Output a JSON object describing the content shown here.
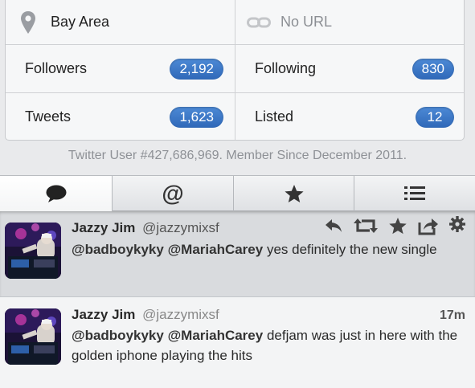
{
  "profile": {
    "location": "Bay Area",
    "url": "No URL",
    "followers_label": "Followers",
    "followers_count": "2,192",
    "following_label": "Following",
    "following_count": "830",
    "tweets_label": "Tweets",
    "tweets_count": "1,623",
    "listed_label": "Listed",
    "listed_count": "12",
    "member_line": "Twitter User #427,686,969. Member Since December 2011."
  },
  "tabs": [
    {
      "icon": "speech-bubble-icon"
    },
    {
      "icon": "at-icon"
    },
    {
      "icon": "star-icon"
    },
    {
      "icon": "list-icon"
    }
  ],
  "tweets": [
    {
      "name": "Jazzy Jim",
      "handle": "@jazzymixsf",
      "mention1": "@badboykyky",
      "mention2": "@MariahCarey",
      "text": " yes definitely the new single",
      "time": "",
      "selected": true,
      "actions": [
        "reply-icon",
        "retweet-icon",
        "favorite-star-icon",
        "share-icon",
        "gear-icon"
      ]
    },
    {
      "name": "Jazzy Jim",
      "handle": "@jazzymixsf",
      "mention1": "@badboykyky",
      "mention2": "@MariahCarey",
      "text": " defjam was just in here with the golden iphone playing the hits",
      "time": "17m",
      "selected": false
    }
  ],
  "colors": {
    "accent": "#3a77c8",
    "background": "#e9eaec",
    "card": "#f6f7f8",
    "selected_tweet": "#d9dbde"
  }
}
